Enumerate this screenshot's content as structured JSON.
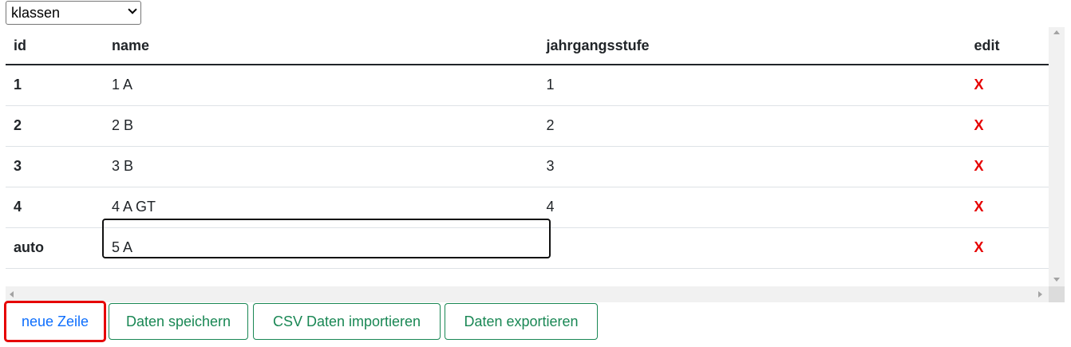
{
  "table_select": {
    "value": "klassen"
  },
  "columns": [
    "id",
    "name",
    "jahrgangsstufe",
    "edit"
  ],
  "rows": [
    {
      "id": "1",
      "name": "1 A",
      "jahrgangsstufe": "1",
      "edit": "X"
    },
    {
      "id": "2",
      "name": "2 B",
      "jahrgangsstufe": "2",
      "edit": "X"
    },
    {
      "id": "3",
      "name": "3 B",
      "jahrgangsstufe": "3",
      "edit": "X"
    },
    {
      "id": "4",
      "name": "4 A GT",
      "jahrgangsstufe": "4",
      "edit": "X"
    },
    {
      "id": "auto",
      "name": "5 A",
      "jahrgangsstufe": "",
      "edit": "X"
    }
  ],
  "buttons": {
    "new_row": "neue Zeile",
    "save": "Daten speichern",
    "import_csv": "CSV Daten importieren",
    "export": "Daten exportieren"
  },
  "colors": {
    "delete": "#e60000",
    "button_primary_text": "#0d6efd",
    "button_outline": "#198754",
    "highlight_border": "#e60000"
  }
}
